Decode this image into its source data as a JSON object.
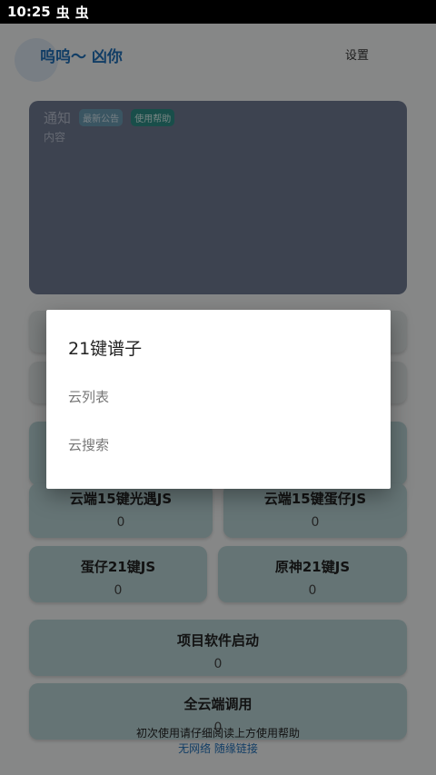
{
  "status_bar": {
    "time": "10:25",
    "icons": [
      "bug-icon",
      "bug-icon"
    ],
    "glyph": "虫"
  },
  "header": {
    "title": "呜呜～ 凶你",
    "settings_label": "设置"
  },
  "notice": {
    "title": "通知",
    "badge_announcement": "最新公告",
    "badge_help": "使用帮助",
    "content": "内容"
  },
  "cards": [
    {
      "name": "云端15键光遇JS",
      "count": "0"
    },
    {
      "name": "云端15键蛋仔JS",
      "count": "0"
    },
    {
      "name": "蛋仔21键JS",
      "count": "0"
    },
    {
      "name": "原神21键JS",
      "count": "0"
    },
    {
      "name": "项目软件启动",
      "count": "0"
    },
    {
      "name": "全云端调用",
      "count": "0"
    }
  ],
  "footer": {
    "text": "初次使用请仔细阅读上方使用帮助",
    "links": "无网络  随缘链接"
  },
  "dialog": {
    "title": "21键谱子",
    "items": [
      "云列表",
      "云搜索"
    ]
  },
  "colors": {
    "accent": "#1f6fb8",
    "card": "#b8d3d5",
    "notice_bg": "#707a92"
  }
}
